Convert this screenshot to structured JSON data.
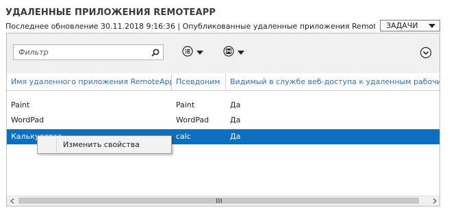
{
  "header": {
    "title": "УДАЛЕННЫЕ ПРИЛОЖЕНИЯ REMOTEAPP",
    "subtitle": "Последнее обновление 30.11.2018 9:16:36 | Опубликованные удаленные приложения RemoteAp...",
    "tasks_label": "ЗАДАЧИ"
  },
  "toolbar": {
    "filter_placeholder": "Фильтр",
    "icons": [
      "search-icon",
      "list-options-icon",
      "save-icon",
      "expand-icon"
    ]
  },
  "table": {
    "columns": [
      "Имя удаленного приложения RemoteApp",
      "Псевдоним",
      "Видимый в службе веб-доступа к удаленным рабочим столам"
    ],
    "rows": [
      {
        "name": "Paint",
        "alias": "Paint",
        "visible": "Да",
        "selected": false
      },
      {
        "name": "WordPad",
        "alias": "WordPad",
        "visible": "Да",
        "selected": false
      },
      {
        "name": "Калькулятор",
        "alias": "calc",
        "visible": "Да",
        "selected": true
      }
    ]
  },
  "context_menu": {
    "items": [
      "Изменить свойства"
    ]
  },
  "colors": {
    "selection": "#0e6ebf",
    "header_text": "#2a72b8",
    "toolbar_bg": "#f0f0f0"
  }
}
